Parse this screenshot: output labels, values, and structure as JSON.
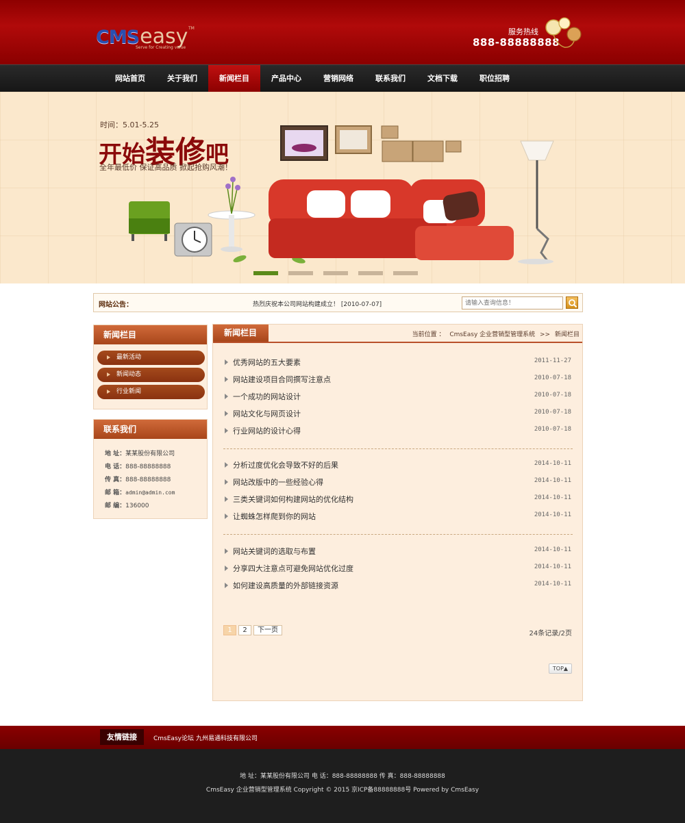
{
  "header": {
    "logo_main": "CMS",
    "logo_accent": "easy",
    "logo_tm": "TM",
    "logo_tagline": "Serve for Creating value",
    "hotline_label": "服务热线",
    "hotline_number": "888-88888888"
  },
  "nav": {
    "items": [
      {
        "label": "网站首页"
      },
      {
        "label": "关于我们"
      },
      {
        "label": "新闻栏目"
      },
      {
        "label": "产品中心"
      },
      {
        "label": "营销网络"
      },
      {
        "label": "联系我们"
      },
      {
        "label": "文档下载"
      },
      {
        "label": "职位招聘"
      }
    ],
    "active_index": 2
  },
  "banner": {
    "date_text": "时间：5.01-5.25",
    "title_a": "开始",
    "title_b": "装修",
    "title_c": "吧",
    "subtitle": "全年最低价  保证高品质  掀起抢购风潮！",
    "slide_count": 5,
    "active_slide": 0
  },
  "notice": {
    "label": "网站公告：",
    "text": "热烈庆祝本公司网站构建成立！ [2010-07-07]",
    "search_placeholder": "请输入查询信息！"
  },
  "sidebar": {
    "news_title": "新闻栏目",
    "news_items": [
      {
        "label": "最新活动"
      },
      {
        "label": "新闻动态"
      },
      {
        "label": "行业新闻"
      }
    ],
    "contact_title": "联系我们",
    "contact": [
      {
        "k": "地 址：",
        "v": "某某股份有限公司"
      },
      {
        "k": "电 话：",
        "v": "888-88888888"
      },
      {
        "k": "传 真：",
        "v": "888-88888888"
      },
      {
        "k": "邮 箱：",
        "v": "admin@admin.com"
      },
      {
        "k": "邮 编：",
        "v": "136000"
      }
    ]
  },
  "main": {
    "tab_title": "新闻栏目",
    "crumb_prefix": "当前位置 ：",
    "crumb_site": "CmsEasy 企业营销型管理系统",
    "crumb_sep": ">>",
    "crumb_current": "新闻栏目",
    "news_groups": [
      [
        {
          "title": "优秀网站的五大要素",
          "date": "2011-11-27"
        },
        {
          "title": "网站建设项目合同撰写注意点",
          "date": "2010-07-18"
        },
        {
          "title": "一个成功的网站设计",
          "date": "2010-07-18"
        },
        {
          "title": "网站文化与网页设计",
          "date": "2010-07-18"
        },
        {
          "title": "行业网站的设计心得",
          "date": "2010-07-18"
        }
      ],
      [
        {
          "title": "分析过度优化会导致不好的后果",
          "date": "2014-10-11"
        },
        {
          "title": "网站改版中的一些经验心得",
          "date": "2014-10-11"
        },
        {
          "title": "三类关键词如何构建网站的优化结构",
          "date": "2014-10-11"
        },
        {
          "title": "让蜘蛛怎样爬到你的网站",
          "date": "2014-10-11"
        }
      ],
      [
        {
          "title": "网站关键词的选取与布置",
          "date": "2014-10-11"
        },
        {
          "title": "分享四大注意点可避免网站优化过度",
          "date": "2014-10-11"
        },
        {
          "title": "如何建设高质量的外部链接资源",
          "date": "2014-10-11"
        }
      ]
    ],
    "pager": {
      "pages": [
        "1",
        "2"
      ],
      "current": "1",
      "next_label": "下一页",
      "records": "24条记录/2页"
    },
    "top_label": "TOP▲"
  },
  "links": {
    "label": "友情链接",
    "items": [
      {
        "label": "CmsEasy论坛"
      },
      {
        "label": "九州易通科技有限公司"
      }
    ]
  },
  "footer": {
    "line1": "地 址：某某股份有限公司    电 话：888-88888888    传 真：888-88888888",
    "line2": "CmsEasy 企业营销型管理系统 Copyright © 2015    京ICP备88888888号    Powered by  CmsEasy"
  },
  "colors": {
    "header_red": "#a00808",
    "nav_black": "#1a1a1a",
    "accent_brown": "#b8502a",
    "panel_bg": "#fdeede"
  }
}
